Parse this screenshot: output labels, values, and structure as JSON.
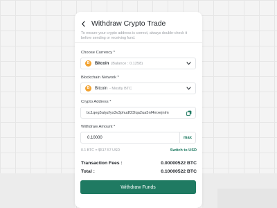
{
  "header": {
    "title": "Withdraw Crypto Trade",
    "subtitle": "To ensure your crypto address is correct, always double-check it before sending or receiving fund."
  },
  "currency": {
    "label": "Choose Currency *",
    "coin_glyph": "B",
    "name": "Bitcoin",
    "balance": "(Balance : 0.1258)"
  },
  "network": {
    "label": "Blockchain Network *",
    "coin_glyph": "B",
    "name": "Bitcoin",
    "detail": "- Mostly BTC"
  },
  "address": {
    "label": "Crypto Address *",
    "value": "bc1qeg5atyzfys3v3phudf23lqa2ua5nf4mxejnlm"
  },
  "amount": {
    "label": "Withdraw Amount *",
    "value": "0.10000",
    "max_label": "max",
    "rate": "0.1 BTC = $517.57 USD",
    "switch_label": "Switch to USD"
  },
  "summary": {
    "fees_label": "Transaction Fees :",
    "fees_value": "0.00000522 BTC",
    "total_label": "Total :",
    "total_value": "0.10000522 BTC"
  },
  "action": {
    "withdraw_label": "Withdraw Funds"
  },
  "colors": {
    "accent": "#1f7a62",
    "coin": "#f2a230",
    "background": "#f4f4f4"
  },
  "icons": {
    "back": "arrow-left-icon",
    "coin": "bitcoin-icon",
    "dropdown": "chevron-down-icon",
    "copy": "copy-icon"
  }
}
